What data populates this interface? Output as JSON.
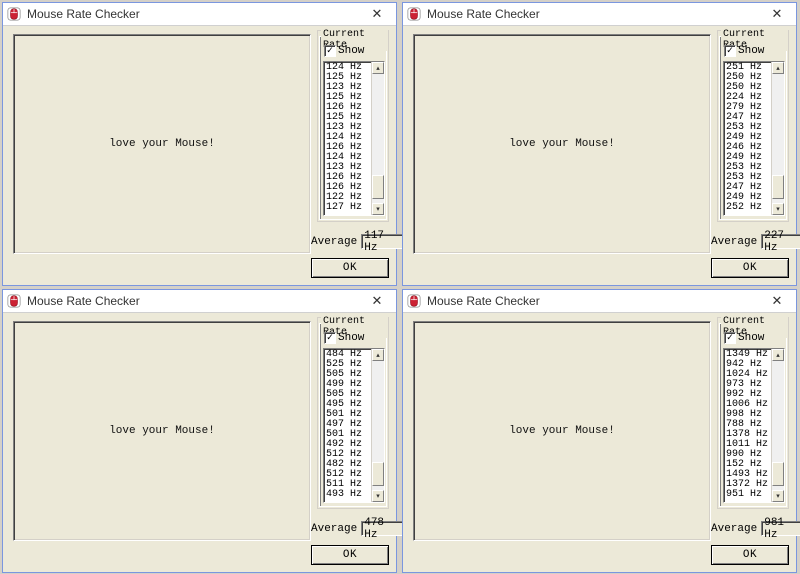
{
  "app_title": "Mouse Rate Checker",
  "main_message": "love your Mouse!",
  "close_char": "✕",
  "group_label": "Current Rate",
  "show_label": "Show",
  "show_checked_char": "✓",
  "average_label": "Average",
  "ok_label": "OK",
  "checkmark": "✓",
  "windows": [
    {
      "id": "tl",
      "average": "117 Hz",
      "rates": [
        "124 Hz",
        "125 Hz",
        "123 Hz",
        "125 Hz",
        "126 Hz",
        "125 Hz",
        "123 Hz",
        "124 Hz",
        "126 Hz",
        "124 Hz",
        "123 Hz",
        "126 Hz",
        "126 Hz",
        "122 Hz",
        "127 Hz"
      ]
    },
    {
      "id": "tr",
      "average": "227 Hz",
      "rates": [
        "251 Hz",
        "250 Hz",
        "250 Hz",
        "224 Hz",
        "279 Hz",
        "247 Hz",
        "253 Hz",
        "249 Hz",
        "246 Hz",
        "249 Hz",
        "253 Hz",
        "253 Hz",
        "247 Hz",
        "249 Hz",
        "252 Hz"
      ]
    },
    {
      "id": "bl",
      "average": "478 Hz",
      "rates": [
        "484 Hz",
        "525 Hz",
        "505 Hz",
        "499 Hz",
        "505 Hz",
        "495 Hz",
        "501 Hz",
        "497 Hz",
        "501 Hz",
        "492 Hz",
        "512 Hz",
        "482 Hz",
        "512 Hz",
        "511 Hz",
        "493 Hz"
      ]
    },
    {
      "id": "br",
      "average": "981 Hz",
      "rates": [
        "1349 Hz",
        "942 Hz",
        "1024 Hz",
        "973 Hz",
        "992 Hz",
        "1006 Hz",
        "998 Hz",
        "788 Hz",
        "1378 Hz",
        "1011 Hz",
        "990 Hz",
        "152 Hz",
        "1493 Hz",
        "1372 Hz",
        "951 Hz"
      ]
    }
  ]
}
